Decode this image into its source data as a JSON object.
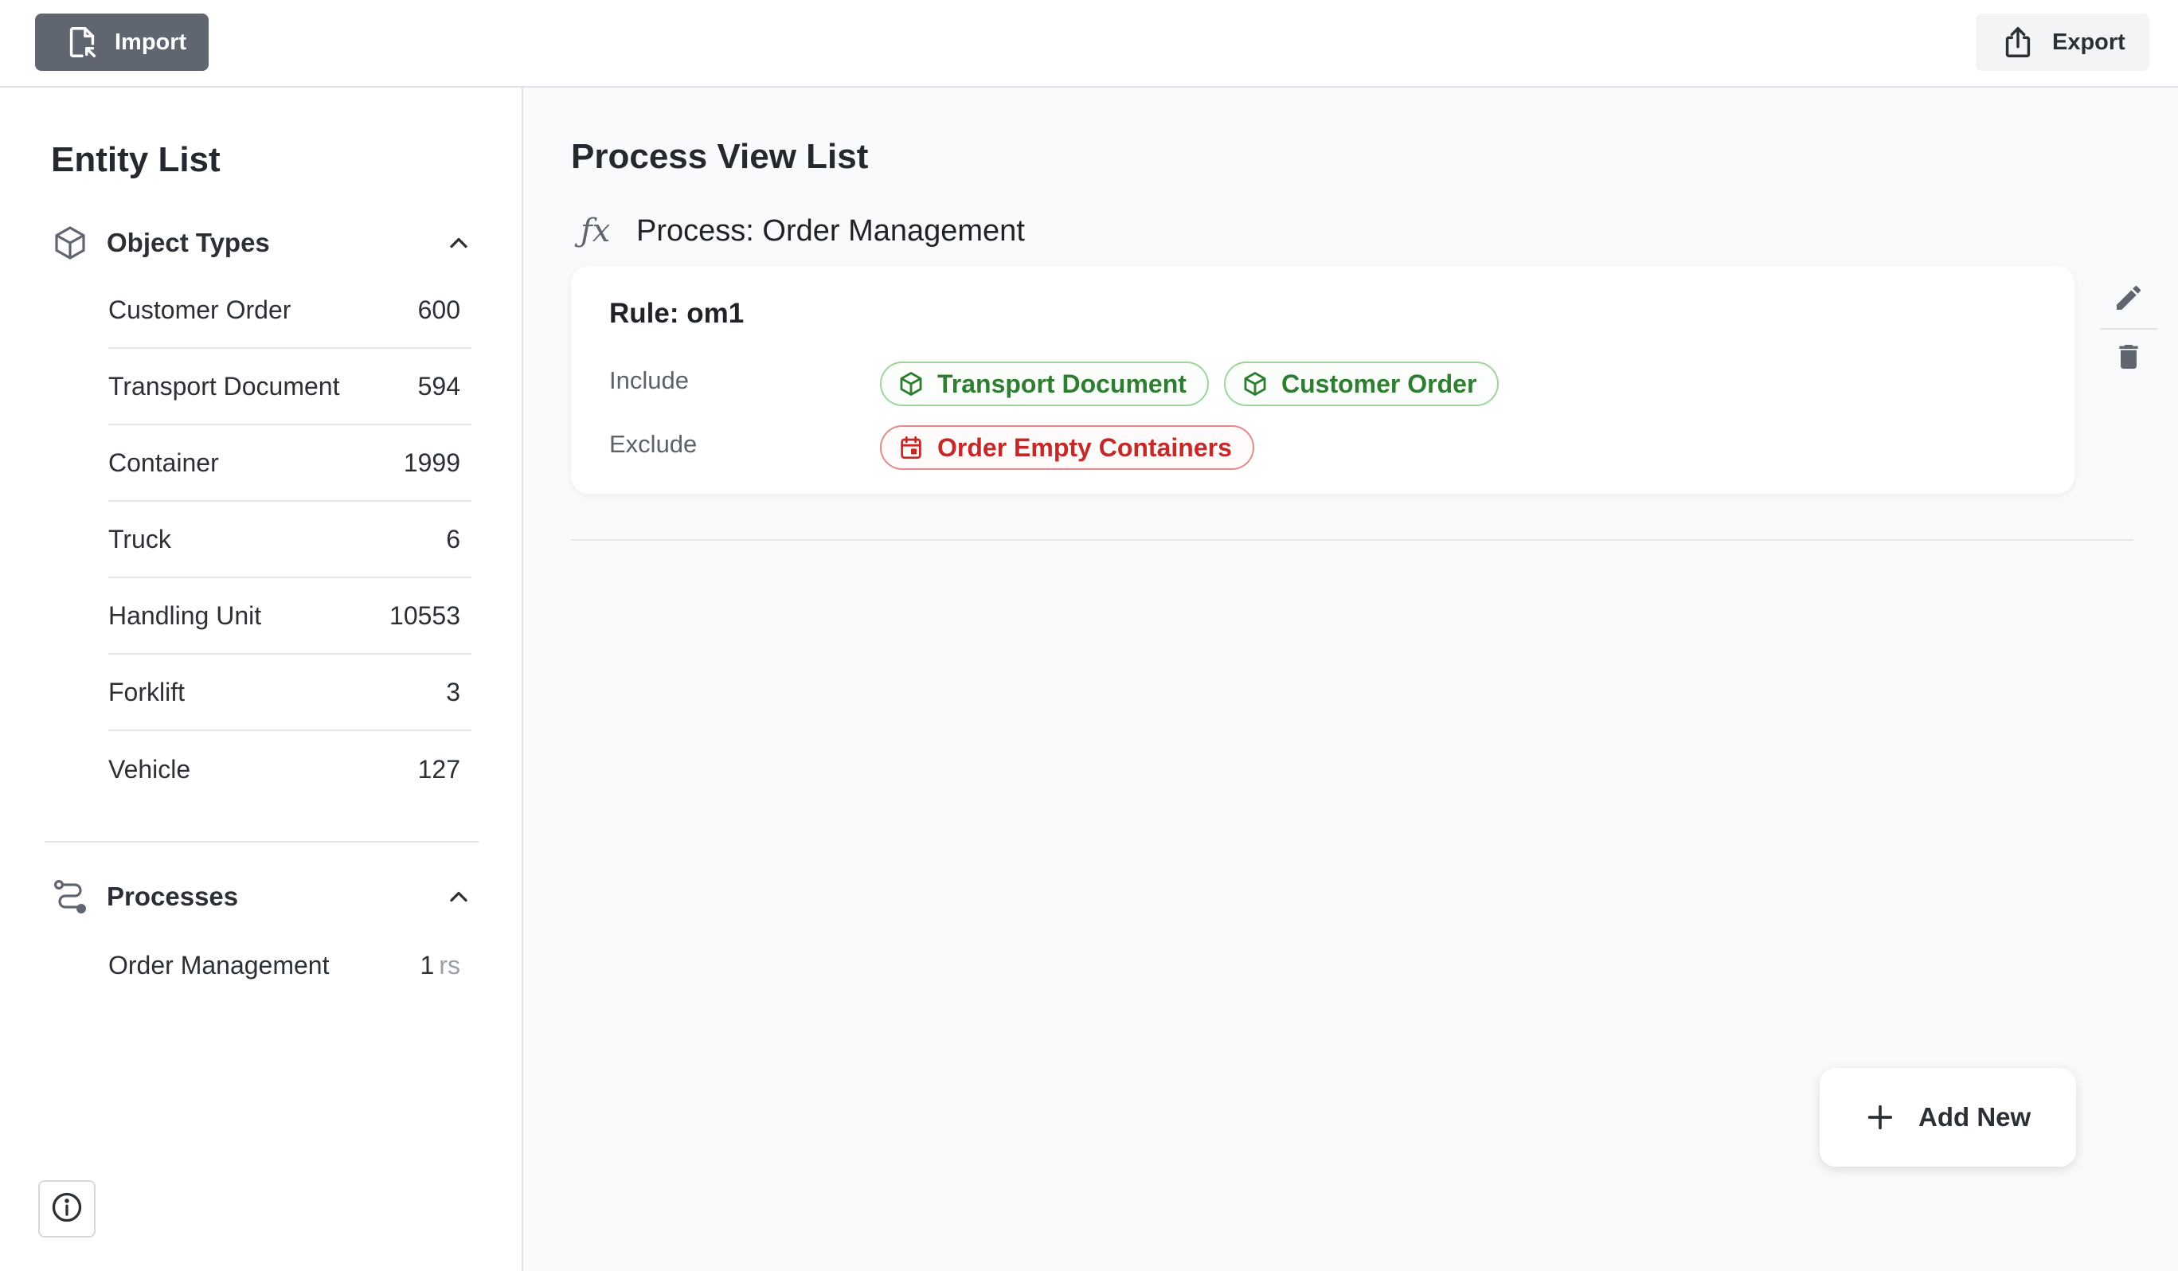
{
  "toolbar": {
    "import_label": "Import",
    "export_label": "Export"
  },
  "sidebar": {
    "title": "Entity List",
    "object_types": {
      "label": "Object Types",
      "items": [
        {
          "name": "Customer Order",
          "count": "600"
        },
        {
          "name": "Transport Document",
          "count": "594"
        },
        {
          "name": "Container",
          "count": "1999"
        },
        {
          "name": "Truck",
          "count": "6"
        },
        {
          "name": "Handling Unit",
          "count": "10553"
        },
        {
          "name": "Forklift",
          "count": "3"
        },
        {
          "name": "Vehicle",
          "count": "127"
        }
      ]
    },
    "processes": {
      "label": "Processes",
      "items": [
        {
          "name": "Order Management",
          "count": "1",
          "suffix": "rs"
        }
      ]
    }
  },
  "main": {
    "title": "Process View List",
    "process": {
      "title": "Process: Order Management",
      "rule": {
        "title": "Rule: om1",
        "include_label": "Include",
        "exclude_label": "Exclude",
        "include": [
          "Transport Document",
          "Customer Order"
        ],
        "exclude": [
          "Order Empty Containers"
        ]
      }
    },
    "add_new_label": "Add New"
  },
  "colors": {
    "include_green": "#2e7d32",
    "exclude_red": "#c62828",
    "import_button_bg": "#5f6670"
  },
  "icons": {
    "import": "file-import-icon",
    "export": "share-export-icon",
    "object_types": "cube-icon",
    "processes": "route-icon",
    "process_view": "fx-icon",
    "edit": "pencil-icon",
    "delete": "trash-icon",
    "include_chip": "cube-icon",
    "exclude_chip": "calendar-event-icon",
    "info": "info-icon",
    "add": "plus-icon"
  }
}
